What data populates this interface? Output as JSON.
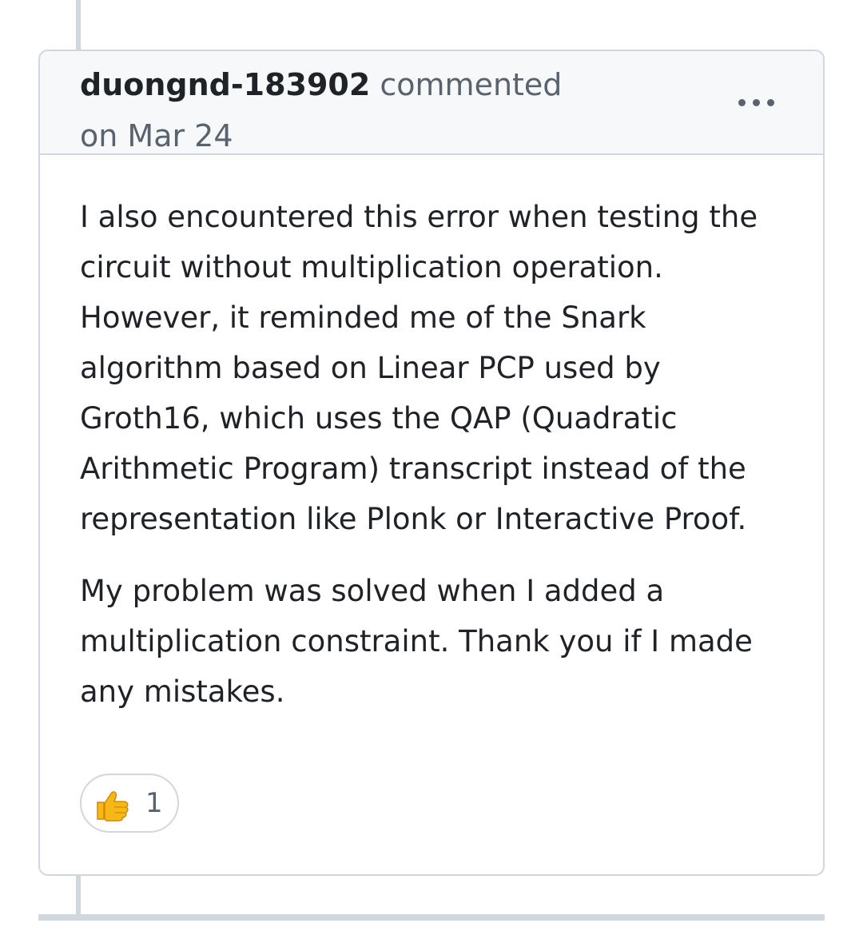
{
  "comment": {
    "author": "duongnd-183902",
    "action": "commented",
    "date": "on Mar 24",
    "more_icon": "kebab-horizontal-icon",
    "paragraphs": [
      "I also encountered this error when testing the circuit without multiplication operation. However, it reminded me of the Snark algorithm based on Linear PCP used by Groth16, which uses the QAP (Quadratic Arithmetic Program) transcript instead of the representation like Plonk or Interactive Proof.",
      "My problem was solved when I added a multiplication constraint. Thank you if I made any mistakes."
    ],
    "reaction": {
      "icon": "thumbs-up-icon",
      "count": "1"
    }
  },
  "colors": {
    "border": "#d0d7de",
    "header_bg": "#f6f8fa",
    "text": "#1f2328",
    "muted_text": "#59636e",
    "thumb": "#f5b817"
  }
}
